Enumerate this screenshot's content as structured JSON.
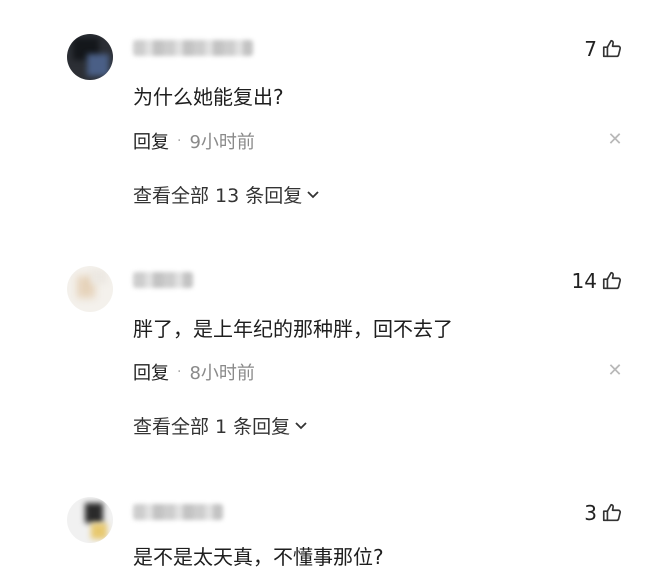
{
  "comments": [
    {
      "text": "为什么她能复出?",
      "likes": "7",
      "reply_label": "回复",
      "separator": "·",
      "time": "9小时前",
      "view_replies": "查看全部 13 条回复"
    },
    {
      "text": "胖了，是上年纪的那种胖，回不去了",
      "likes": "14",
      "reply_label": "回复",
      "separator": "·",
      "time": "8小时前",
      "view_replies": "查看全部 1 条回复"
    },
    {
      "text": "是不是太天真，不懂事那位?",
      "likes": "3"
    }
  ],
  "icons": {
    "like": "thumbs-up-icon",
    "close": "close-icon",
    "chevron": "chevron-down-icon"
  }
}
